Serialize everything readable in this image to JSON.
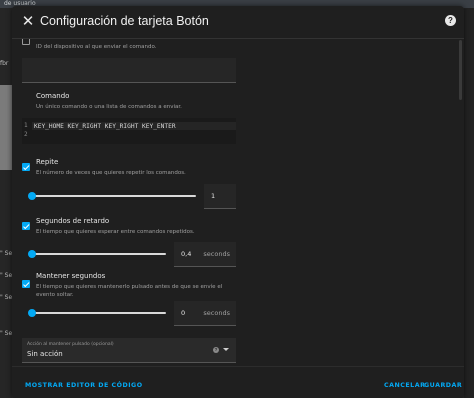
{
  "background": {
    "top_tag": "de usuario",
    "left_tags": [
      "fbr",
      "\" Se",
      "\" Se",
      "\" Se",
      "\" Se"
    ]
  },
  "dialog": {
    "title": "Configuración de tarjeta Botón",
    "close_icon": "close-icon",
    "help_icon": "help-circle-icon"
  },
  "device": {
    "helper": "ID del dispositivo al que enviar el comando."
  },
  "command": {
    "label": "Comando",
    "helper": "Un único comando o una lista de comandos a enviar.",
    "line_numbers": [
      "1",
      "2"
    ],
    "code": "KEY_HOME KEY_RIGHT KEY_RIGHT KEY_ENTER"
  },
  "repeat": {
    "label": "Repite",
    "helper": "El número de veces que quieres repetir los comandos.",
    "checked": true,
    "value": "1",
    "slider_fraction": 0.0
  },
  "delay": {
    "label": "Segundos de retardo",
    "helper": "El tiempo que quieres esperar entre comandos repetidos.",
    "checked": true,
    "value": "0,4",
    "unit": "seconds",
    "slider_fraction": 0.0
  },
  "hold": {
    "label": "Mantener segundos",
    "helper_line1": "El tiempo que quieres mantenerlo pulsado antes de que se envíe el",
    "helper_line2": "evento soltar.",
    "checked": true,
    "value": "0",
    "unit": "seconds",
    "slider_fraction": 0.0
  },
  "hold_action": {
    "label": "Acción al mantener pulsado (opcional)",
    "value": "Sin acción"
  },
  "footer": {
    "code_editor": "MOSTRAR EDITOR DE CÓDIGO",
    "cancel": "CANCELAR",
    "save": "GUARDAR"
  },
  "colors": {
    "accent": "#03a9f4",
    "dialog_bg": "#1f1f1f"
  }
}
